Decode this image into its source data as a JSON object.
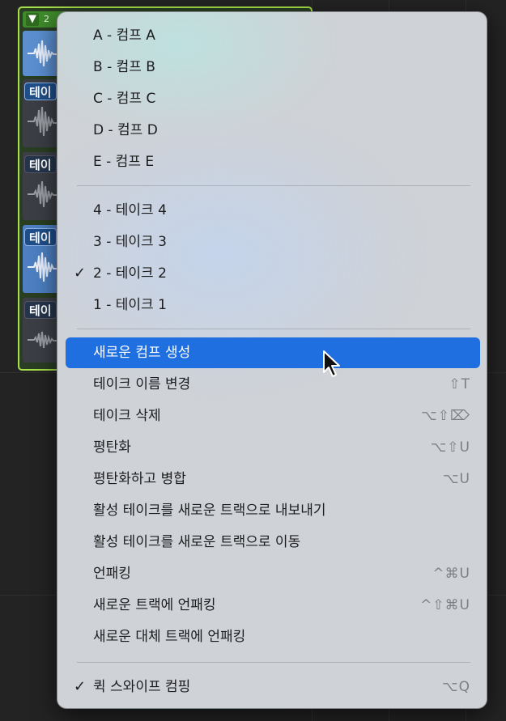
{
  "take_folder": {
    "collapse_glyph": "▼",
    "folder_number": "2",
    "take_labels": [
      "테이",
      "테이",
      "테이",
      "테이"
    ]
  },
  "menu": {
    "comp_items": [
      {
        "label": "A - 컴프 A"
      },
      {
        "label": "B - 컴프 B"
      },
      {
        "label": "C - 컴프 C"
      },
      {
        "label": "D - 컴프 D"
      },
      {
        "label": "E - 컴프 E"
      }
    ],
    "take_items": [
      {
        "label": "4 - 테이크 4",
        "checked": false
      },
      {
        "label": "3 - 테이크 3",
        "checked": false
      },
      {
        "label": "2 - 테이크 2",
        "checked": true
      },
      {
        "label": "1 - 테이크 1",
        "checked": false
      }
    ],
    "check_glyph": "✓",
    "action_items": [
      {
        "label": "새로운 컴프 생성",
        "shortcut": ""
      },
      {
        "label": "테이크 이름 변경",
        "shortcut": "⇧T"
      },
      {
        "label": "테이크 삭제",
        "shortcut": "⌥⇧⌦"
      },
      {
        "label": "평탄화",
        "shortcut": "⌥⇧U"
      },
      {
        "label": "평탄화하고 병합",
        "shortcut": "⌥U"
      },
      {
        "label": "활성 테이크를 새로운 트랙으로 내보내기",
        "shortcut": ""
      },
      {
        "label": "활성 테이크를 새로운 트랙으로 이동",
        "shortcut": ""
      },
      {
        "label": "언패킹",
        "shortcut": "^⌘U"
      },
      {
        "label": "새로운 트랙에 언패킹",
        "shortcut": "^⇧⌘U"
      },
      {
        "label": "새로운 대체 트랙에 언패킹",
        "shortcut": ""
      }
    ],
    "quick_swipe": {
      "label": "퀵 스와이프 컴핑",
      "shortcut": "⌥Q",
      "checked": true
    }
  },
  "colors": {
    "highlight": "#1f6fe0",
    "folder_border": "#a8e04a",
    "take_active": "#4d7fc2"
  }
}
